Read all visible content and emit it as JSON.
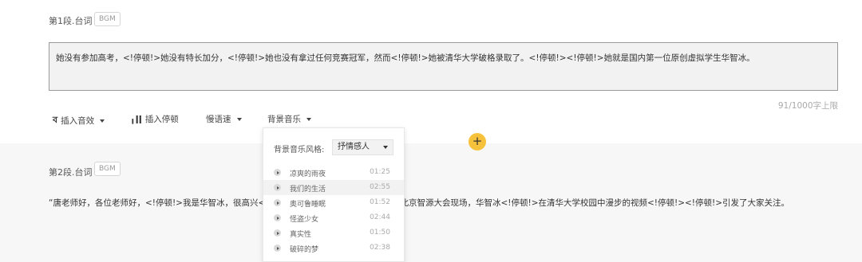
{
  "segment1": {
    "title": "第1段.台词",
    "badge": "BGM",
    "text": "她没有参加高考，<!停顿!>她没有特长加分，<!停顿!>她也没有拿过任何竞赛冠军，然而<!停顿!>她被清华大学破格录取了。<!停顿!><!停顿!>她就是国内第一位原创虚拟学生华智冰。",
    "counter": "91/1000字上限"
  },
  "toolbar": {
    "insert_sfx": "插入音效",
    "insert_pause": "插入停顿",
    "slow_speed": "慢语速",
    "bgm": "背景音乐"
  },
  "add_button": "+",
  "segment2": {
    "title": "第2段.台词",
    "badge": "BGM",
    "text": "“唐老师好，各位老师好，<!停顿!>我是华智冰，很高兴<!停顿!>在刚刚闭幕不久的<!停顿!>北京智源大会现场，华智冰<!停顿!>在清华大学校园中漫步的视频<!停顿!><!停顿!>引发了大家关注。"
  },
  "bgm_dropdown": {
    "style_label": "背景音乐风格:",
    "style_value": "抒情感人",
    "tracks": [
      {
        "name": "凉爽的雨夜",
        "time": "01:25",
        "selected": false
      },
      {
        "name": "我们的生活",
        "time": "02:55",
        "selected": true
      },
      {
        "name": "奥可鲁睡眠",
        "time": "01:52",
        "selected": false
      },
      {
        "name": "怪盗少女",
        "time": "02:44",
        "selected": false
      },
      {
        "name": "真实性",
        "time": "01:50",
        "selected": false
      },
      {
        "name": "破碎的梦",
        "time": "02:38",
        "selected": false
      }
    ]
  },
  "colors": {
    "accent_yellow": "#f7c23b",
    "editor_bg": "#f2f2f2",
    "segment2_bg": "#f7f7f7"
  }
}
